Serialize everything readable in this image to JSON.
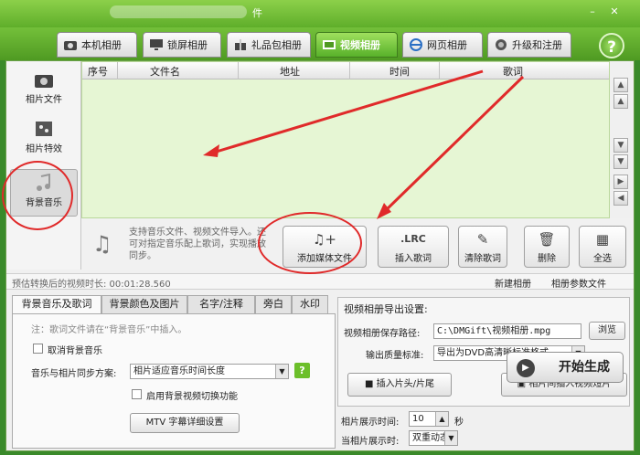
{
  "window": {
    "title_suffix": "件",
    "minimize": "–",
    "close": "✕"
  },
  "tabs": [
    {
      "label": "本机相册",
      "icon": "camera-icon"
    },
    {
      "label": "锁屏相册",
      "icon": "monitor-icon"
    },
    {
      "label": "礼品包相册",
      "icon": "gift-icon"
    },
    {
      "label": "视频相册",
      "icon": "film-icon",
      "active": true
    },
    {
      "label": "网页相册",
      "icon": "ie-icon"
    },
    {
      "label": "升级和注册",
      "icon": "globe-icon"
    }
  ],
  "help": "?",
  "sidebar": [
    {
      "label": "相片文件",
      "icon": "camera-icon"
    },
    {
      "label": "相片特效",
      "icon": "effects-icon"
    },
    {
      "label": "背景音乐",
      "icon": "music-note-icon",
      "active": true
    }
  ],
  "grid": {
    "columns": [
      "序号",
      "文件名",
      "地址",
      "时间",
      "歌词"
    ]
  },
  "scroll": {
    "top": "▲",
    "up": "▲",
    "down": "▼",
    "bottom": "▼",
    "right": "▶",
    "left": "◀"
  },
  "toolbar": {
    "note": "支持音乐文件、视频文件导入。还可对指定音乐配上歌词，实现播放同步。",
    "buttons": [
      {
        "label": "添加媒体文件",
        "glyph": "♫+"
      },
      {
        "label": "插入歌词",
        "glyph": ".LRC"
      },
      {
        "label": "清除歌词",
        "glyph": "✎"
      },
      {
        "label": "删除",
        "glyph": "🗑"
      },
      {
        "label": "全选",
        "glyph": "▦"
      }
    ]
  },
  "status": {
    "duration": "预估转换后的视频时长:  00:01:28.560",
    "new_album": "新建相册",
    "param_file": "相册参数文件"
  },
  "lower_tabs": [
    "背景音乐及歌词",
    "背景颜色及图片",
    "名字/注释",
    "旁白",
    "水印"
  ],
  "left_panel": {
    "hint": "注：歌词文件请在“背景音乐”中插入。",
    "cancel_bg_music": "取消背景音乐",
    "sync_label": "音乐与相片同步方案:",
    "sync_value": "相片适应音乐时间长度",
    "enable_switch": "启用背景视频切换功能",
    "mtv_button": "MTV  字幕详细设置"
  },
  "right_panel": {
    "title": "视频相册导出设置:",
    "save_path_label": "视频相册保存路径:",
    "save_path_value": "C:\\DMGift\\视频相册.mpg",
    "browse": "浏览",
    "quality_label": "输出质量标准:",
    "quality_value": "导出为DVD高清晰标准格式",
    "insert_header": "插入片头/片尾",
    "insert_video": "相片间插入视频短片"
  },
  "bottom": {
    "photo_time_label": "相片展示时间:",
    "photo_time_value": "10",
    "photo_time_unit": "秒",
    "photo_mode_label": "当相片展示时:",
    "photo_mode_value": "双重动态",
    "start": "开始生成"
  },
  "colors": {
    "accent_green": "#5fae2a",
    "annotation_red": "#e02a2a",
    "grid_green": "#e6f6d4"
  }
}
